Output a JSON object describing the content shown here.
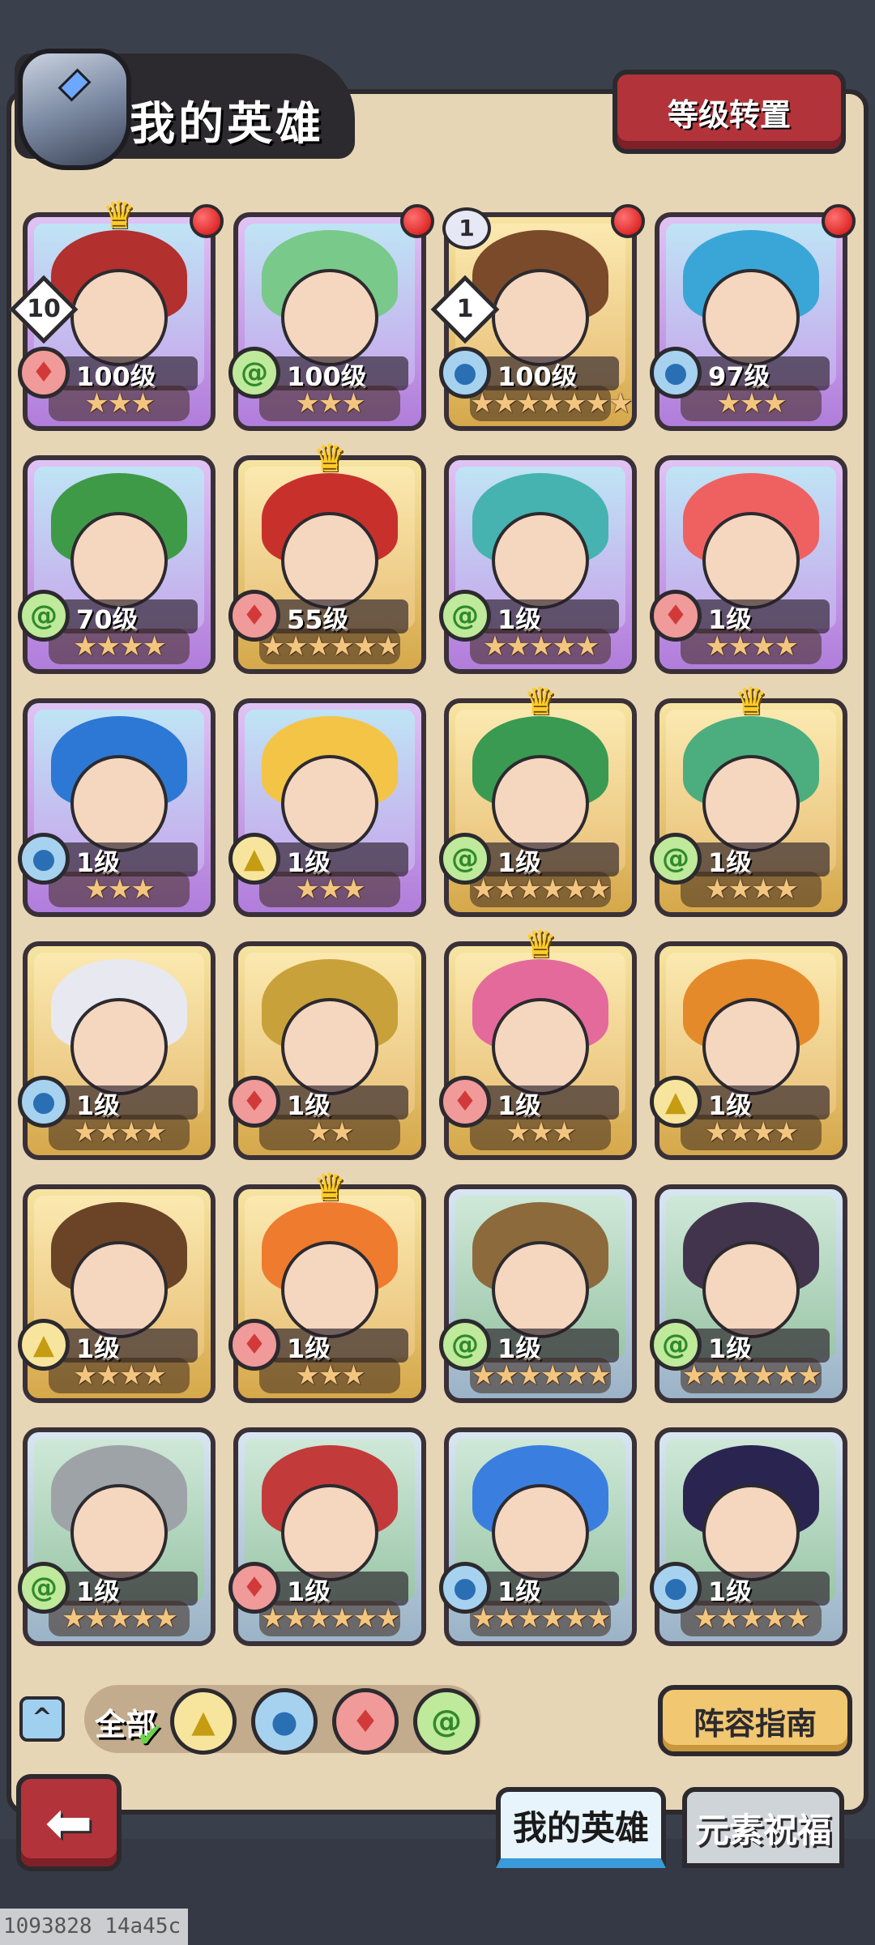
{
  "header": {
    "title": "我的英雄",
    "reset_label": "等级转置"
  },
  "heroes": [
    {
      "level": "100级",
      "stars": "★★★",
      "element": "fire",
      "frame": "purple",
      "crown": true,
      "dot": true,
      "badge": "10",
      "hair": "#b2302d"
    },
    {
      "level": "100级",
      "stars": "★★★",
      "element": "wind",
      "frame": "purple",
      "crown": false,
      "dot": true,
      "badge": "",
      "hair": "#79c98a"
    },
    {
      "level": "100级",
      "stars": "★★★★★★★",
      "element": "water",
      "frame": "gold",
      "crown": false,
      "dot": true,
      "badge": "1",
      "topbadge": "1",
      "hair": "#7a4a2a"
    },
    {
      "level": "97级",
      "stars": "★★★",
      "element": "water",
      "frame": "purple",
      "crown": false,
      "dot": true,
      "badge": "",
      "hair": "#3aa6d8"
    },
    {
      "level": "70级",
      "stars": "★★★★",
      "element": "wind",
      "frame": "purple",
      "crown": false,
      "dot": false,
      "badge": "",
      "hair": "#3f9a48"
    },
    {
      "level": "55级",
      "stars": "★★★★★★",
      "element": "fire",
      "frame": "gold",
      "crown": true,
      "dot": false,
      "badge": "",
      "hair": "#c8312b"
    },
    {
      "level": "1级",
      "stars": "★★★★★",
      "element": "wind",
      "frame": "purple",
      "crown": false,
      "dot": false,
      "badge": "",
      "hair": "#46b3b0"
    },
    {
      "level": "1级",
      "stars": "★★★★",
      "element": "fire",
      "frame": "purple",
      "crown": false,
      "dot": false,
      "badge": "",
      "hair": "#ef6161"
    },
    {
      "level": "1级",
      "stars": "★★★",
      "element": "water",
      "frame": "purple",
      "crown": false,
      "dot": false,
      "badge": "",
      "hair": "#2c78d4"
    },
    {
      "level": "1级",
      "stars": "★★★",
      "element": "earth",
      "frame": "purple",
      "crown": false,
      "dot": false,
      "badge": "",
      "hair": "#f4c446"
    },
    {
      "level": "1级",
      "stars": "★★★★★★",
      "element": "wind",
      "frame": "gold",
      "crown": true,
      "dot": false,
      "badge": "",
      "hair": "#3a9a52"
    },
    {
      "level": "1级",
      "stars": "★★★★",
      "element": "wind",
      "frame": "gold",
      "crown": true,
      "dot": false,
      "badge": "",
      "hair": "#4cae7e"
    },
    {
      "level": "1级",
      "stars": "★★★★",
      "element": "water",
      "frame": "gold",
      "crown": false,
      "dot": false,
      "badge": "",
      "hair": "#e8e8f0"
    },
    {
      "level": "1级",
      "stars": "★★",
      "element": "fire",
      "frame": "gold",
      "crown": false,
      "dot": false,
      "badge": "",
      "hair": "#c9a13a"
    },
    {
      "level": "1级",
      "stars": "★★★",
      "element": "fire",
      "frame": "gold",
      "crown": true,
      "dot": false,
      "badge": "",
      "hair": "#e46a9c"
    },
    {
      "level": "1级",
      "stars": "★★★★",
      "element": "earth",
      "frame": "gold",
      "crown": false,
      "dot": false,
      "badge": "",
      "hair": "#e58a2a"
    },
    {
      "level": "1级",
      "stars": "★★★★",
      "element": "earth",
      "frame": "gold",
      "crown": false,
      "dot": false,
      "badge": "",
      "hair": "#6b4428"
    },
    {
      "level": "1级",
      "stars": "★★★",
      "element": "fire",
      "frame": "gold",
      "crown": true,
      "dot": false,
      "badge": "",
      "hair": "#ef7b2e"
    },
    {
      "level": "1级",
      "stars": "★★★★★★",
      "element": "wind",
      "frame": "blue",
      "crown": false,
      "dot": false,
      "badge": "",
      "hair": "#8c6a3c"
    },
    {
      "level": "1级",
      "stars": "★★★★★★",
      "element": "wind",
      "frame": "blue",
      "crown": false,
      "dot": false,
      "badge": "",
      "hair": "#43344e"
    },
    {
      "level": "1级",
      "stars": "★★★★★",
      "element": "wind",
      "frame": "blue",
      "crown": false,
      "dot": false,
      "badge": "",
      "hair": "#9ea3a8"
    },
    {
      "level": "1级",
      "stars": "★★★★★★",
      "element": "fire",
      "frame": "blue",
      "crown": false,
      "dot": false,
      "badge": "",
      "hair": "#c33a3a"
    },
    {
      "level": "1级",
      "stars": "★★★★★★",
      "element": "water",
      "frame": "blue",
      "crown": false,
      "dot": false,
      "badge": "",
      "hair": "#3a7fe0"
    },
    {
      "level": "1级",
      "stars": "★★★★★",
      "element": "water",
      "frame": "blue",
      "crown": false,
      "dot": false,
      "badge": "",
      "hair": "#2a2450"
    }
  ],
  "filters": {
    "all_label": "全部",
    "elements": [
      "earth",
      "water",
      "fire",
      "wind"
    ]
  },
  "guide_label": "阵容指南",
  "tabs": {
    "my_heroes": "我的英雄",
    "element_blessing": "元素祝福"
  },
  "footer_id": "1093828 14a45c"
}
